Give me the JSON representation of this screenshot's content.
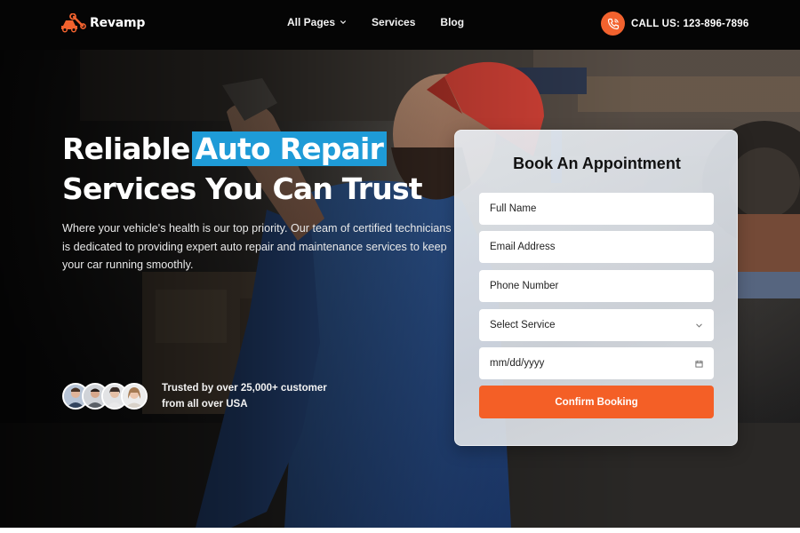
{
  "brand": {
    "name": "Revamp",
    "accent": "#f2622e",
    "highlight": "#1e9bd7"
  },
  "nav": {
    "items": [
      {
        "label": "All Pages",
        "has_dropdown": true
      },
      {
        "label": "Services",
        "has_dropdown": false
      },
      {
        "label": "Blog",
        "has_dropdown": false
      }
    ]
  },
  "header": {
    "call_label": "CALL US: 123-896-7896",
    "call_icon": "phone-icon"
  },
  "hero": {
    "headline_line1_start": "Reliable",
    "headline_highlight": "Auto Repair",
    "headline_line2": "Services You Can Trust",
    "subtext": "Where your vehicle's health is our top priority. Our team of certified technicians is dedicated to providing expert auto repair and maintenance services to keep your car running smoothly.",
    "trust_line1": "Trusted by over 25,000+ customer",
    "trust_line2": "from all over USA"
  },
  "form": {
    "title": "Book An Appointment",
    "full_name_placeholder": "Full Name",
    "email_placeholder": "Email Address",
    "phone_placeholder": "Phone Number",
    "service_select_value": "Select Service",
    "date_placeholder": "mm/dd/yyyy",
    "submit_label": "Confirm Booking"
  }
}
